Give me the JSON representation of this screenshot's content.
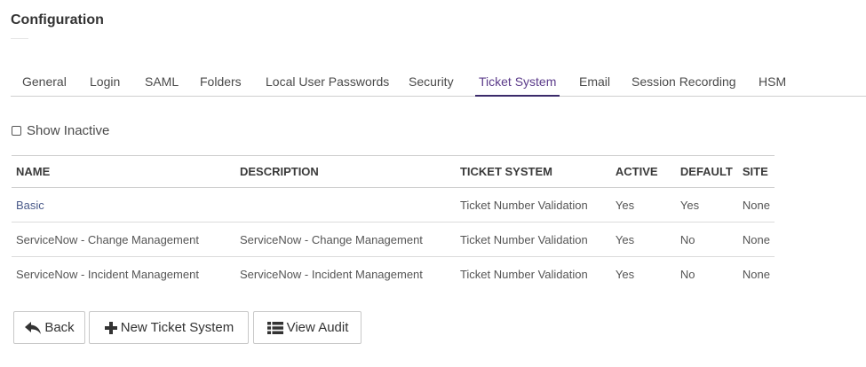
{
  "header": {
    "title": "Configuration"
  },
  "tabs": [
    {
      "label": "General",
      "active": false
    },
    {
      "label": "Login",
      "active": false
    },
    {
      "label": "SAML",
      "active": false
    },
    {
      "label": "Folders",
      "active": false
    },
    {
      "label": "Local User Passwords",
      "active": false
    },
    {
      "label": "Security",
      "active": false
    },
    {
      "label": "Ticket System",
      "active": true
    },
    {
      "label": "Email",
      "active": false
    },
    {
      "label": "Session Recording",
      "active": false
    },
    {
      "label": "HSM",
      "active": false
    }
  ],
  "filter": {
    "show_inactive_label": "Show Inactive",
    "show_inactive_checked": false
  },
  "table": {
    "columns": [
      "NAME",
      "DESCRIPTION",
      "TICKET SYSTEM",
      "ACTIVE",
      "DEFAULT",
      "SITE"
    ],
    "rows": [
      {
        "name": "Basic",
        "description": "",
        "ticket_system": "Ticket Number Validation",
        "active": "Yes",
        "default": "Yes",
        "site": "None"
      },
      {
        "name": "ServiceNow - Change Management",
        "description": "ServiceNow - Change Management",
        "ticket_system": "Ticket Number Validation",
        "active": "Yes",
        "default": "No",
        "site": "None"
      },
      {
        "name": "ServiceNow - Incident Management",
        "description": "ServiceNow - Incident Management",
        "ticket_system": "Ticket Number Validation",
        "active": "Yes",
        "default": "No",
        "site": "None"
      }
    ]
  },
  "buttons": {
    "back": {
      "label": "Back",
      "icon": "reply-arrow-icon"
    },
    "new_ticket_system": {
      "label": "New Ticket System",
      "icon": "plus-icon"
    },
    "view_audit": {
      "label": "View Audit",
      "icon": "list-icon"
    }
  },
  "colors": {
    "active_tab_text": "#5b3b8a",
    "active_tab_underline": "#3a2a6a",
    "link": "#4a5a8a"
  }
}
